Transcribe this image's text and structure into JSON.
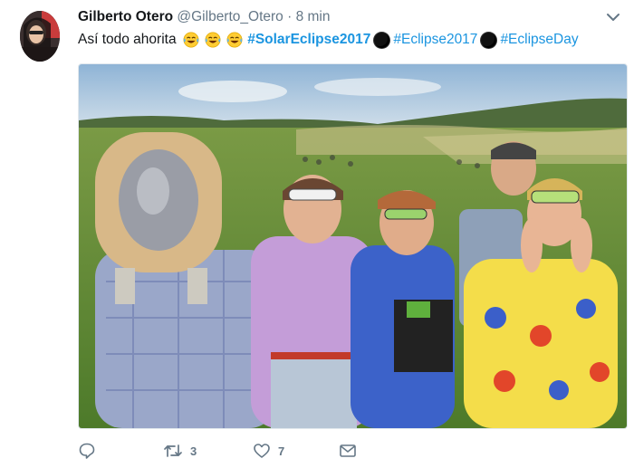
{
  "tweet": {
    "author_name": "Gilberto Otero",
    "handle": "@Gilberto_Otero",
    "separator": "·",
    "time": "8 min",
    "text": "Así todo ahorita",
    "hashtags": [
      "#SolarEclipse2017",
      "#Eclipse2017",
      "#EclipseDay"
    ]
  },
  "actions": {
    "reply_count": "",
    "retweet_count": "3",
    "like_count": "7"
  },
  "icons": [
    "reply-icon",
    "retweet-icon",
    "like-icon",
    "message-icon",
    "chevron-down-icon",
    "laughing-tears-emoji",
    "new-moon-emoji"
  ],
  "colors": {
    "hashtag": "#1b95e0",
    "muted": "#657786",
    "text": "#14171a"
  }
}
